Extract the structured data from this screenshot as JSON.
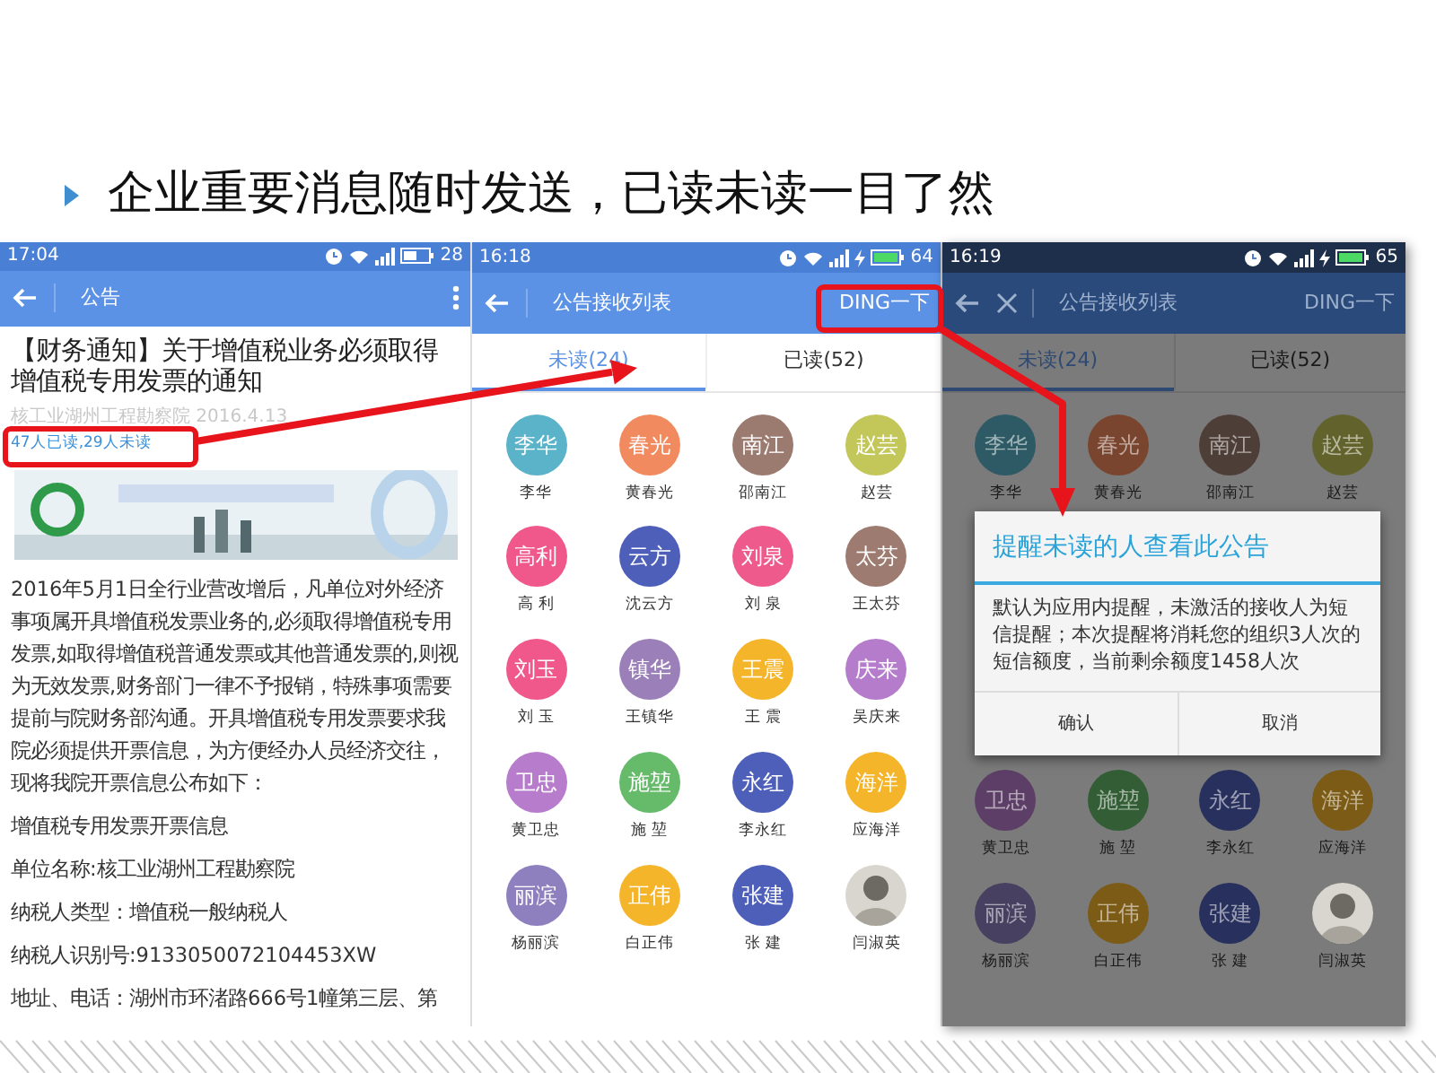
{
  "slide": {
    "title": "企业重要消息随时发送，已读未读一目了然"
  },
  "phones": [
    {
      "kind": "article",
      "status_bar": {
        "time": "17:04",
        "battery": "28",
        "charging": false
      },
      "app_bar": {
        "title": "公告",
        "menu_button": true,
        "close_button": false
      },
      "article": {
        "title": "【财务通知】关于增值税业务必须取得增值税专用发票的通知",
        "byline": "核工业湖州工程勘察院 2016.4.13",
        "read_stats": "47人已读,29人未读",
        "paragraphs": [
          "2016年5月1日全行业营改增后，凡单位对外经济事项属开具增值税发票业务的,必须取得增值税专用发票,如取得增值税普通发票或其他普通发票的,则视为无效发票,财务部门一律不予报销，特殊事项需要提前与院财务部沟通。开具增值税专用发票要求我院必须提供开票信息，为方便经办人员经济交往，现将我院开票信息公布如下：",
          "增值税专用发票开票信息",
          "单位名称:核工业湖州工程勘察院",
          "纳税人类型：增值税一般纳税人",
          "纳税人识别号:9133050072104453XW",
          "地址、电话：湖州市环渚路666号1幢第三层、第"
        ]
      }
    },
    {
      "kind": "recipients",
      "status_bar": {
        "time": "16:18",
        "battery": "64",
        "charging": true
      },
      "app_bar": {
        "title": "公告接收列表",
        "action": "DING一下",
        "menu_button": false,
        "close_button": false
      },
      "dimmed": false,
      "tabs": [
        {
          "label": "未读(24)",
          "selected": true
        },
        {
          "label": "已读(52)",
          "selected": false
        }
      ],
      "people": [
        {
          "avatar": "李华",
          "name": "李华",
          "color": "#5ab3c8"
        },
        {
          "avatar": "春光",
          "name": "黄春光",
          "color": "#f28a5f"
        },
        {
          "avatar": "南江",
          "name": "邵南江",
          "color": "#9b7b70"
        },
        {
          "avatar": "赵芸",
          "name": "赵芸",
          "color": "#c3c659"
        },
        {
          "avatar": "高利",
          "name": "高 利",
          "color": "#f0578a"
        },
        {
          "avatar": "云方",
          "name": "沈云方",
          "color": "#4e5fba"
        },
        {
          "avatar": "刘泉",
          "name": "刘 泉",
          "color": "#ef5a8c"
        },
        {
          "avatar": "太芬",
          "name": "王太芬",
          "color": "#9d7b70"
        },
        {
          "avatar": "刘玉",
          "name": "刘 玉",
          "color": "#f0578a"
        },
        {
          "avatar": "镇华",
          "name": "王镇华",
          "color": "#9a7fb8"
        },
        {
          "avatar": "王震",
          "name": "王 震",
          "color": "#f5b52a"
        },
        {
          "avatar": "庆来",
          "name": "吴庆来",
          "color": "#b57ccc"
        },
        {
          "avatar": "卫忠",
          "name": "黄卫忠",
          "color": "#b87ccc"
        },
        {
          "avatar": "施堃",
          "name": "施 堃",
          "color": "#66bb6a"
        },
        {
          "avatar": "永红",
          "name": "李永红",
          "color": "#4e5fba"
        },
        {
          "avatar": "海洋",
          "name": "应海洋",
          "color": "#f5b52a"
        },
        {
          "avatar": "丽滨",
          "name": "杨丽滨",
          "color": "#8e7fbf"
        },
        {
          "avatar": "正伟",
          "name": "白正伟",
          "color": "#f5b52a"
        },
        {
          "avatar": "张建",
          "name": "张 建",
          "color": "#4e5fba"
        },
        {
          "kind": "picture",
          "name": "闫淑英"
        }
      ]
    },
    {
      "kind": "recipients",
      "status_bar": {
        "time": "16:19",
        "battery": "65",
        "charging": true
      },
      "app_bar": {
        "title": "公告接收列表",
        "action": "DING一下",
        "menu_button": false,
        "close_button": true
      },
      "dimmed": true,
      "tabs": [
        {
          "label": "未读(24)",
          "selected": true
        },
        {
          "label": "已读(52)",
          "selected": false
        }
      ],
      "people": [
        {
          "avatar": "李华",
          "name": "李华",
          "color": "#2d5a64"
        },
        {
          "avatar": "春光",
          "name": "黄春光",
          "color": "#79452f"
        },
        {
          "avatar": "南江",
          "name": "邵南江",
          "color": "#4e3e38"
        },
        {
          "avatar": "赵芸",
          "name": "赵芸",
          "color": "#62632c"
        }
      ],
      "dialog": {
        "title": "提醒未读的人查看此公告",
        "message": "默认为应用内提醒，未激活的接收人为短信提醒；本次提醒将消耗您的组织3人次的短信额度，当前剩余额度1458人次",
        "buttons": [
          "确认",
          "取消"
        ]
      },
      "people_below": [
        {
          "avatar": "卫忠",
          "name": "黄卫忠",
          "color": "#5c3e66"
        },
        {
          "avatar": "施堃",
          "name": "施 堃",
          "color": "#335e35"
        },
        {
          "avatar": "永红",
          "name": "李永红",
          "color": "#28305d"
        },
        {
          "avatar": "海洋",
          "name": "应海洋",
          "color": "#7b5b15"
        },
        {
          "avatar": "丽滨",
          "name": "杨丽滨",
          "color": "#474060"
        },
        {
          "avatar": "正伟",
          "name": "白正伟",
          "color": "#7b5b15"
        },
        {
          "avatar": "张建",
          "name": "张 建",
          "color": "#28305d"
        },
        {
          "kind": "picture",
          "name": "闫淑英"
        }
      ]
    }
  ]
}
